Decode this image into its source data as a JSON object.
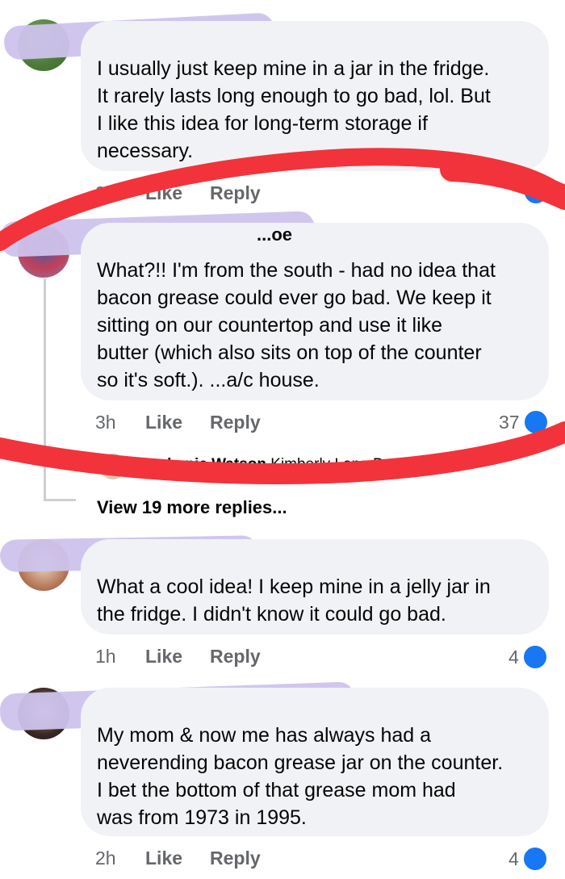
{
  "comments": [
    {
      "text_lines": [
        "I usually just keep mine in a jar in the fridge.",
        "It rarely lasts long enough to go bad, lol.  But",
        "I like this idea for long-term storage if",
        "necessary."
      ],
      "time": "2h",
      "like_label": "Like",
      "reply_label": "Reply"
    },
    {
      "author_fragment": "...oe",
      "text_lines": [
        "What?!!  I'm from the south - had no idea that",
        "bacon grease could ever go bad.  We keep it",
        "sitting on our countertop and use it like",
        "butter (which also sits on top of the counter",
        "so it's soft.).  ...a/c house."
      ],
      "time": "3h",
      "like_label": "Like",
      "reply_label": "Reply",
      "reactions": "37"
    },
    {
      "text_lines": [
        "What a cool idea!  I keep mine in a jelly jar in",
        "the fridge.  I didn't know it could go bad."
      ],
      "time": "1h",
      "like_label": "Like",
      "reply_label": "Reply",
      "reactions": "4"
    },
    {
      "text_lines": [
        "My mom & now me has always had a",
        "neverending bacon grease jar on the counter.",
        "I bet the bottom of that grease mom had",
        "was from 1973 in 1995."
      ],
      "time": "2h",
      "like_label": "Like",
      "reply_label": "Reply",
      "reactions": "4"
    }
  ],
  "reply_preview": {
    "author": "Stephanie Watson",
    "text": "Kimberly Long Do ... exact..."
  },
  "view_more": "View 19 more replies...",
  "colors": {
    "bubble": "#f0f2f5",
    "like_blue": "#1877f2",
    "meta_gray": "#65676b",
    "annotation_red": "#f2333b",
    "redaction_lavender": "#cdc3ec"
  }
}
